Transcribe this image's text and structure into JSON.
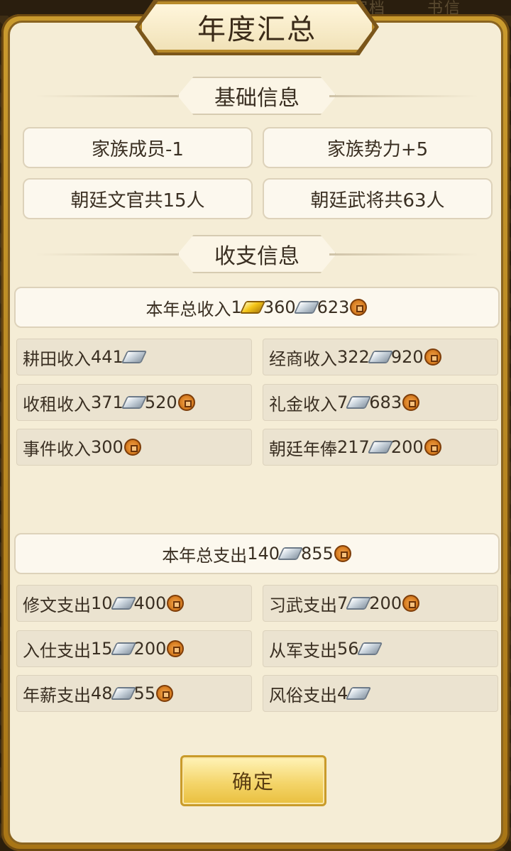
{
  "title": "年度汇总",
  "top_ghost_tabs": [
    "家档",
    "书信"
  ],
  "sections": {
    "basic": "基础信息",
    "finance": "收支信息"
  },
  "basic_info": [
    "家族成员-1",
    "家族势力+5",
    "朝廷文官共15人",
    "朝廷武将共63人"
  ],
  "income": {
    "total": {
      "label": "本年总收入 ",
      "gold": "1",
      "silver": "360",
      "copper": "623"
    },
    "items": [
      {
        "label": "耕田收入",
        "silver": "441",
        "copper": null
      },
      {
        "label": "经商收入",
        "silver": "322",
        "copper": "920"
      },
      {
        "label": "收租收入",
        "silver": "371",
        "copper": "520"
      },
      {
        "label": "礼金收入",
        "silver": "7",
        "copper": "683"
      },
      {
        "label": "事件收入",
        "silver": null,
        "copper": "300"
      },
      {
        "label": "朝廷年俸",
        "silver": "217",
        "copper": "200"
      }
    ]
  },
  "expense": {
    "total": {
      "label": "本年总支出",
      "silver": "140",
      "copper": "855"
    },
    "items": [
      {
        "label": "修文支出",
        "silver": "10",
        "copper": "400"
      },
      {
        "label": "习武支出",
        "silver": "7",
        "copper": "200"
      },
      {
        "label": "入仕支出",
        "silver": "15",
        "copper": "200"
      },
      {
        "label": "从军支出",
        "silver": "56",
        "copper": null
      },
      {
        "label": "年薪支出",
        "silver": "48",
        "copper": "55"
      },
      {
        "label": "风俗支出",
        "silver": "4",
        "copper": null
      }
    ]
  },
  "icons": {
    "gold": "gold-ingot-icon",
    "silver": "silver-ingot-icon",
    "copper": "copper-coin-icon"
  },
  "confirm_label": "确定"
}
